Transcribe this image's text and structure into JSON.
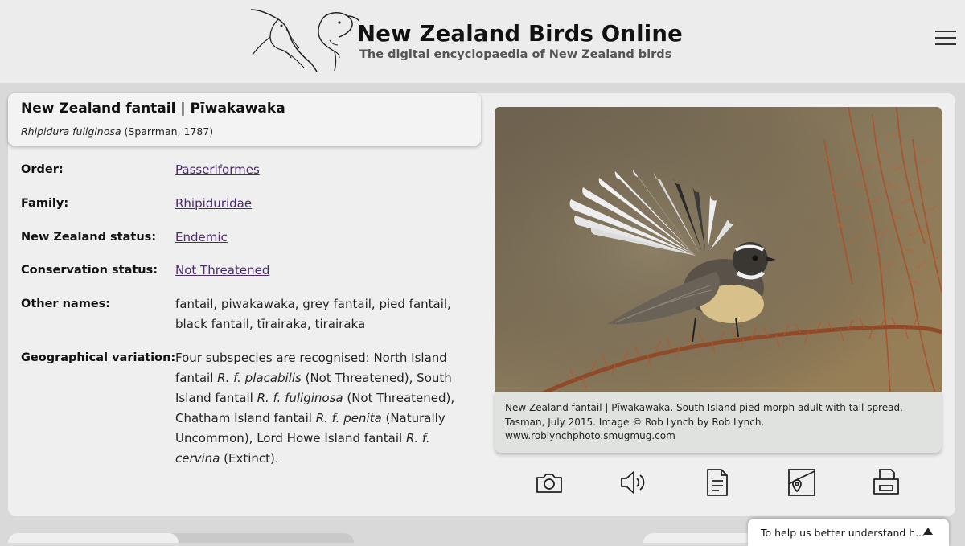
{
  "header": {
    "site_title": "New Zealand Birds Online",
    "site_subtitle": "The digital encyclopaedia of New Zealand birds",
    "menu_icon": "hamburger-menu-icon"
  },
  "species": {
    "common_name": "New Zealand fantail | Pīwakawaka",
    "scientific_name": "Rhipidura fuliginosa",
    "authority": " (Sparrman, 1787)"
  },
  "facts": {
    "order_label": "Order:",
    "order_value": "Passeriformes",
    "family_label": "Family:",
    "family_value": "Rhipiduridae",
    "nz_status_label": "New Zealand status:",
    "nz_status_value": "Endemic",
    "conservation_label": "Conservation status:",
    "conservation_value": "Not Threatened",
    "other_names_label": "Other names:",
    "other_names_value": "fantail, piwakawaka, grey fantail, pied fantail, black fantail, tīrairaka, tirairaka",
    "geo_label": "Geographical variation:",
    "geo_variation": {
      "intro": "Four subspecies are recognised: North Island fantail ",
      "sub1": "R. f. placabilis",
      "status1": " (Not Threatened), South Island fantail ",
      "sub2": "R. f. fuliginosa",
      "status2": " (Not Threatened), Chatham Island fantail ",
      "sub3": "R. f. penita",
      "status3": " (Naturally Uncommon), Lord Howe Island fantail ",
      "sub4": "R. f. cervina",
      "status4": " (Extinct)."
    }
  },
  "image": {
    "caption_line1": "New Zealand fantail | Pīwakawaka. South Island pied morph adult with tail spread.",
    "caption_line2": "Tasman, July 2015. Image © Rob Lynch by Rob Lynch.",
    "caption_line3": "www.roblynchphoto.smugmug.com"
  },
  "actions": [
    {
      "icon": "camera-icon"
    },
    {
      "icon": "sound-icon"
    },
    {
      "icon": "document-icon"
    },
    {
      "icon": "map-icon"
    },
    {
      "icon": "print-icon"
    }
  ],
  "feedback": {
    "text": "To help us better understand h...",
    "icon": "caret-up-icon"
  },
  "colors": {
    "link": "#4b2a6a",
    "card_bg": "#efefef",
    "page_bg": "#d9d9d9",
    "caption_bg": "#e0e2df"
  }
}
